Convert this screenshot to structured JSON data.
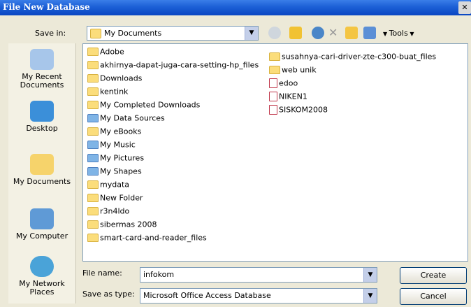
{
  "window": {
    "title": "File New Database"
  },
  "toolbar": {
    "save_in_label": "Save in:",
    "save_in_value": "My Documents",
    "tools_label": "Tools"
  },
  "places": [
    {
      "label": "My Recent Documents",
      "icon": "recent-documents-icon"
    },
    {
      "label": "Desktop",
      "icon": "desktop-icon"
    },
    {
      "label": "My Documents",
      "icon": "my-documents-icon"
    },
    {
      "label": "My Computer",
      "icon": "my-computer-icon"
    },
    {
      "label": "My Network Places",
      "icon": "network-places-icon"
    }
  ],
  "files_col1": [
    "Adobe",
    "akhirnya-dapat-juga-cara-setting-hp_files",
    "Downloads",
    "kentink",
    "My Completed Downloads",
    "My Data Sources",
    "My eBooks",
    "My Music",
    "My Pictures",
    "My Shapes",
    "mydata",
    "New Folder",
    "r3n4ldo",
    "sibermas 2008",
    "smart-card-and-reader_files"
  ],
  "files_col2": [
    "susahnya-cari-driver-zte-c300-buat_files",
    "web unik",
    "edoo",
    "NIKEN1",
    "SISKOM2008"
  ],
  "form": {
    "file_name_label": "File name:",
    "file_name_value": "infokom",
    "save_type_label": "Save as type:",
    "save_type_value": "Microsoft Office Access Database"
  },
  "buttons": {
    "create": "Create",
    "cancel": "Cancel"
  }
}
